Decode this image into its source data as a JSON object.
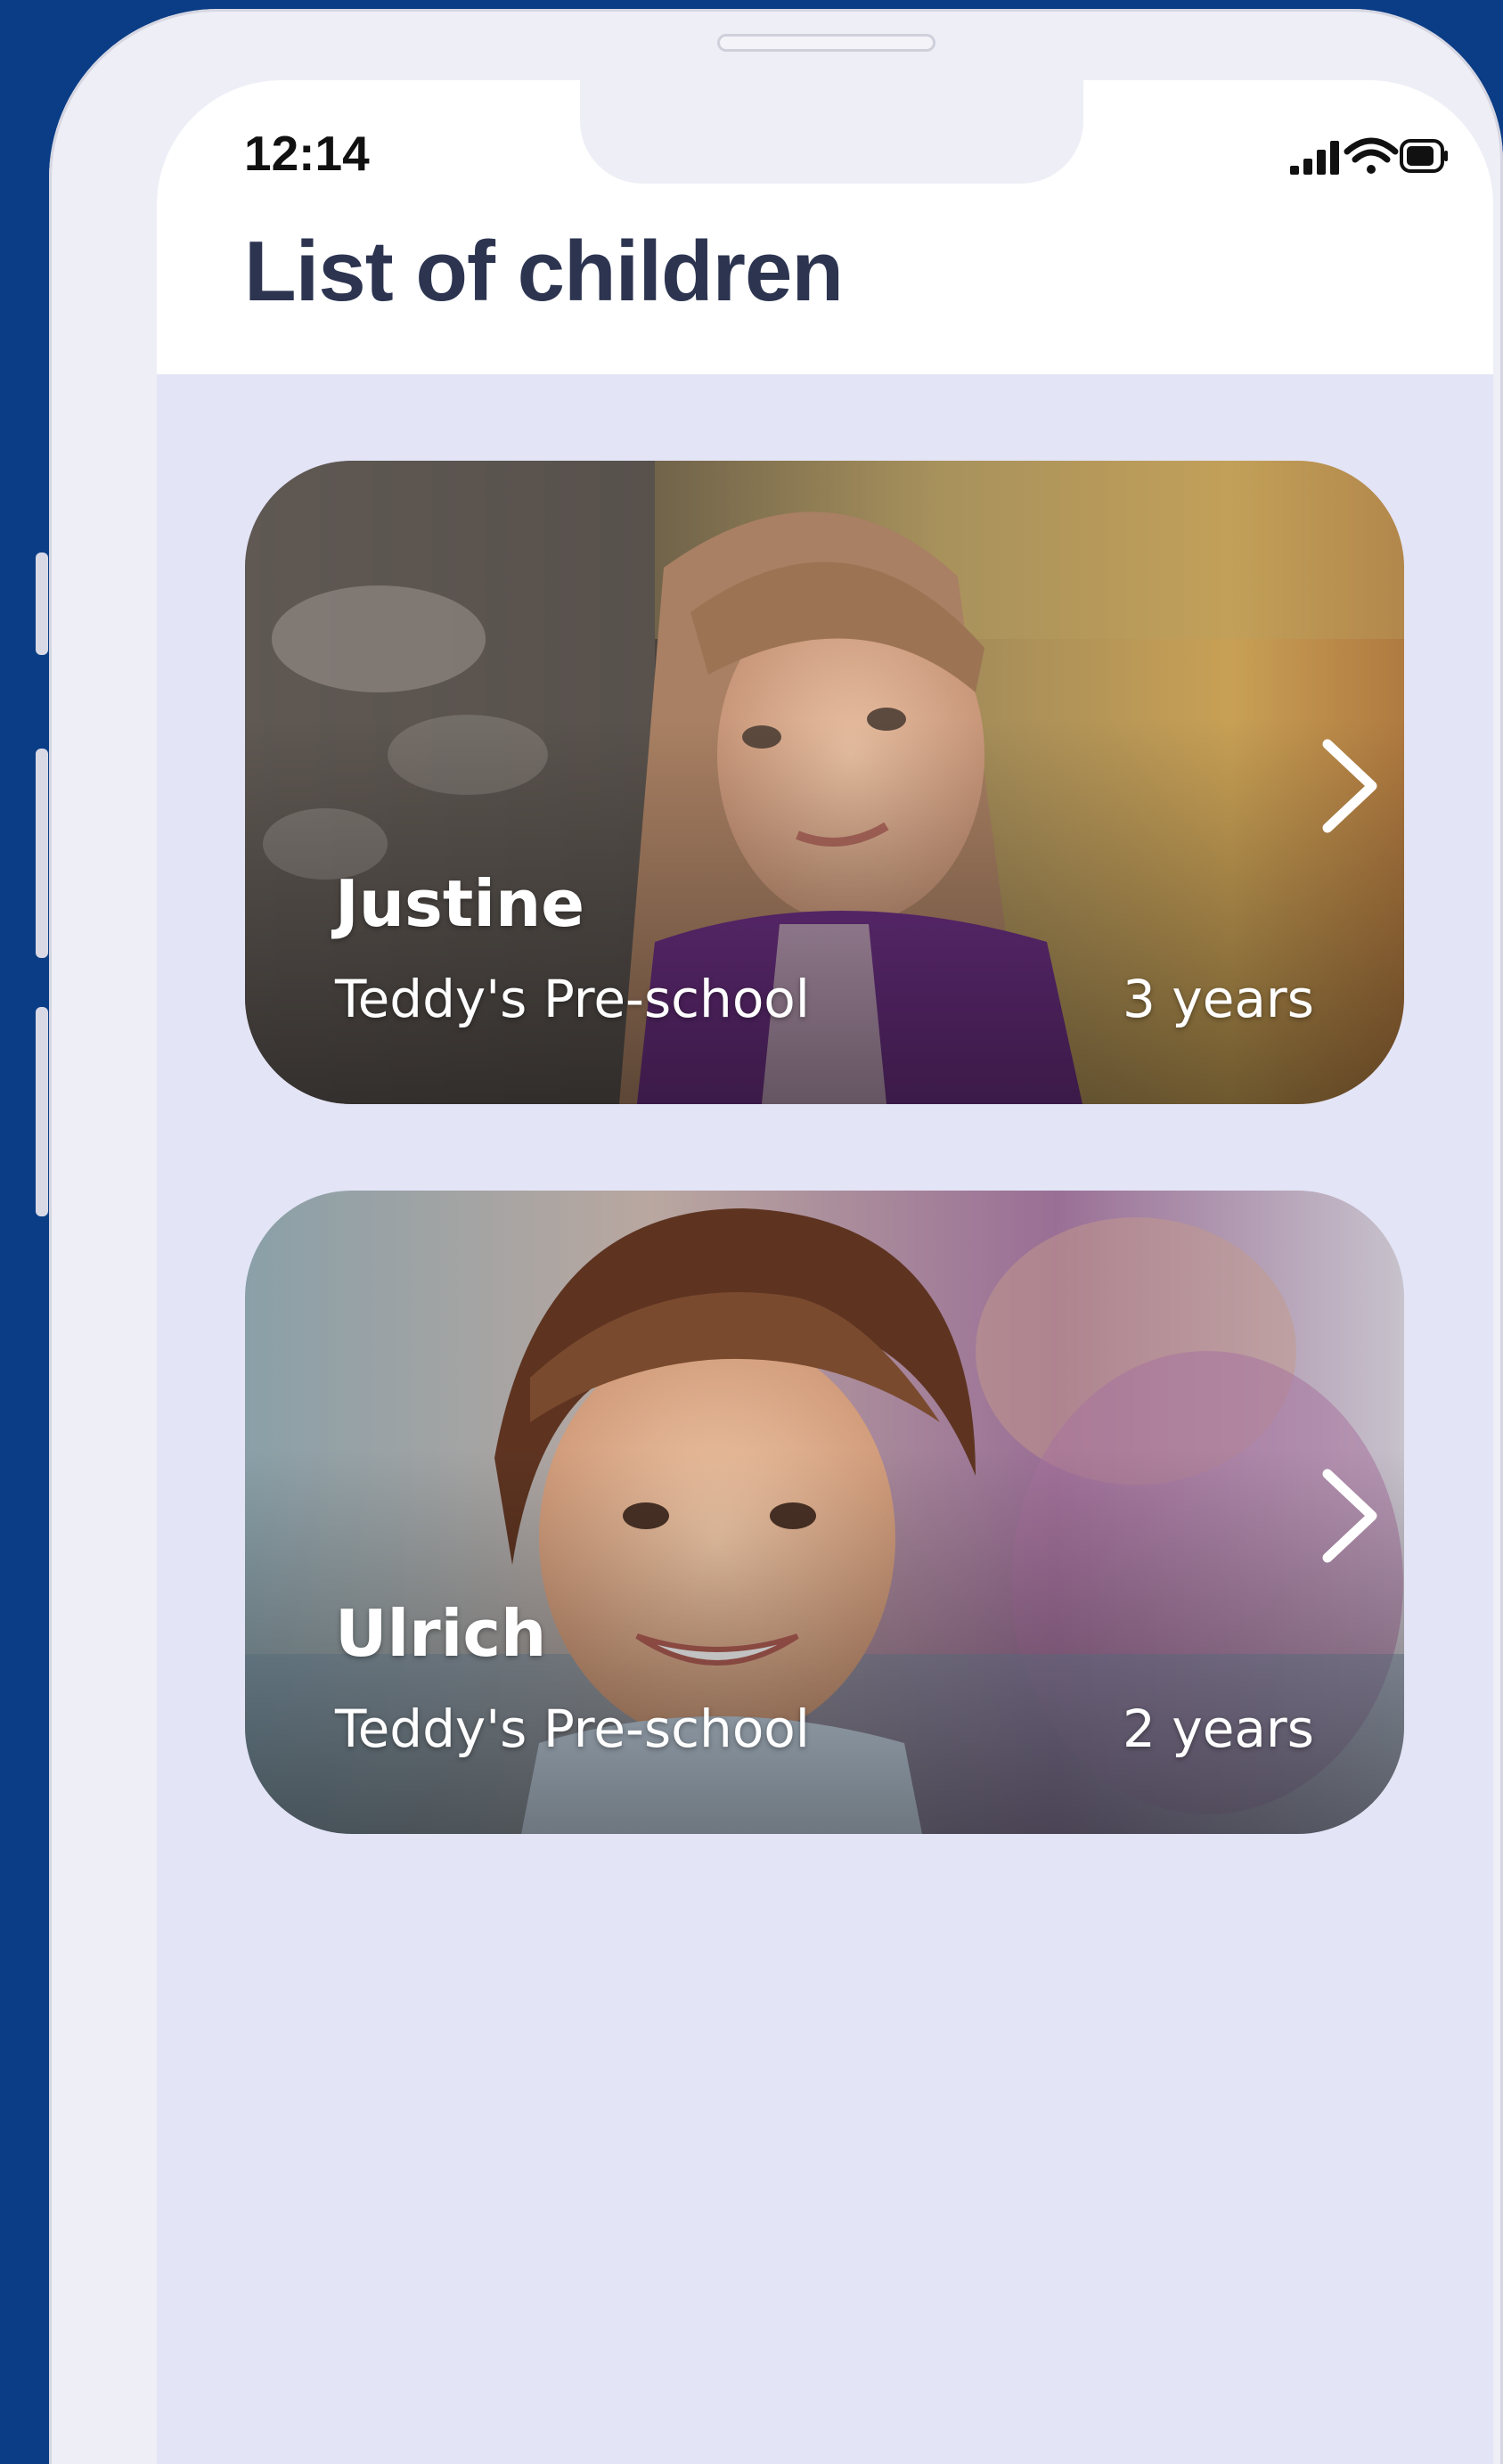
{
  "status_bar": {
    "time": "12:14",
    "icons": [
      "signal-icon",
      "wifi-icon",
      "battery-icon"
    ]
  },
  "header": {
    "title": "List of children"
  },
  "children": [
    {
      "name": "Justine",
      "school": "Teddy's Pre-school",
      "age": "3 years",
      "photo": "girl-portrait-photo"
    },
    {
      "name": "Ulrich",
      "school": "Teddy's Pre-school",
      "age": "2 years",
      "photo": "boy-portrait-photo"
    }
  ],
  "colors": {
    "outer_background": "#0a3d85",
    "screen_background": "#e3e4f6",
    "header_background": "#ffffff",
    "title_text": "#2c3450"
  }
}
